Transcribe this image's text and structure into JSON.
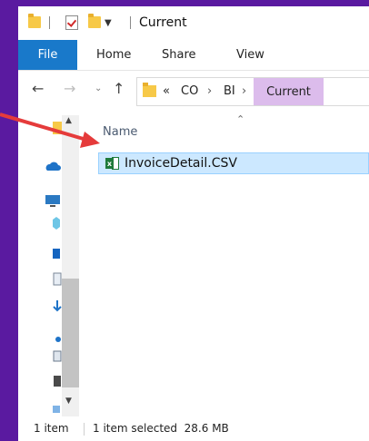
{
  "window": {
    "title": "Current"
  },
  "ribbon": {
    "tabs": [
      "File",
      "Home",
      "Share",
      "View"
    ]
  },
  "address": {
    "overflow": "«",
    "segments": [
      "CO",
      "BI"
    ],
    "current": "Current"
  },
  "icons": {
    "back": "back-arrow-icon",
    "forward": "forward-arrow-icon",
    "recent": "chevron-down-icon",
    "up": "up-arrow-icon",
    "file": "excel-file-icon"
  },
  "list": {
    "column_name": "Name",
    "files": [
      {
        "name": "InvoiceDetail.CSV"
      }
    ]
  },
  "status": {
    "count": "1 item",
    "selection": "1 item selected  28.6 MB"
  },
  "colors": {
    "accent": "#1979ca",
    "selection": "#cce8ff",
    "highlight": "#dcbcec",
    "arrow": "#e53b3b",
    "background": "#5a1aa0"
  }
}
